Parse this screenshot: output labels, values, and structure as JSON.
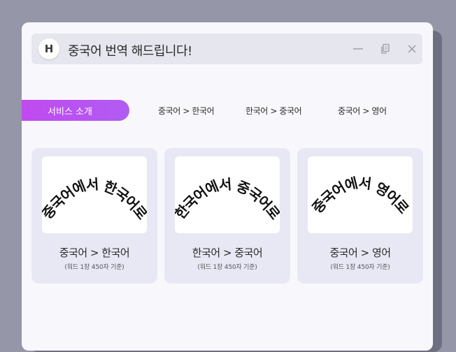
{
  "window": {
    "logo_letter": "H",
    "title": "중국어 번역 해드립니다!"
  },
  "tabs": [
    {
      "label": "서비스 소개",
      "active": true
    },
    {
      "label": "중국어 > 한국어",
      "active": false
    },
    {
      "label": "한국어 > 중국어",
      "active": false
    },
    {
      "label": "중국어 > 영어",
      "active": false
    }
  ],
  "cards": [
    {
      "arc_text": "중국어에서 한국어로",
      "title": "중국어 > 한국어",
      "subtitle": "(워드 1장 450자 기준)"
    },
    {
      "arc_text": "한국어에서 중국어로",
      "title": "한국어 > 중국어",
      "subtitle": "(워드 1장 450자 기준)"
    },
    {
      "arc_text": "중국어에서 영어로",
      "title": "중국어 > 영어",
      "subtitle": "(워드 1장 450자 기준)"
    }
  ],
  "icons": {
    "minimize": "minimize-icon",
    "copy": "copy-icon",
    "close": "close-icon"
  },
  "colors": {
    "accent": "#b84ff1",
    "background": "#9596a8",
    "window": "#f8f8fc",
    "card": "#e8e8f4"
  }
}
